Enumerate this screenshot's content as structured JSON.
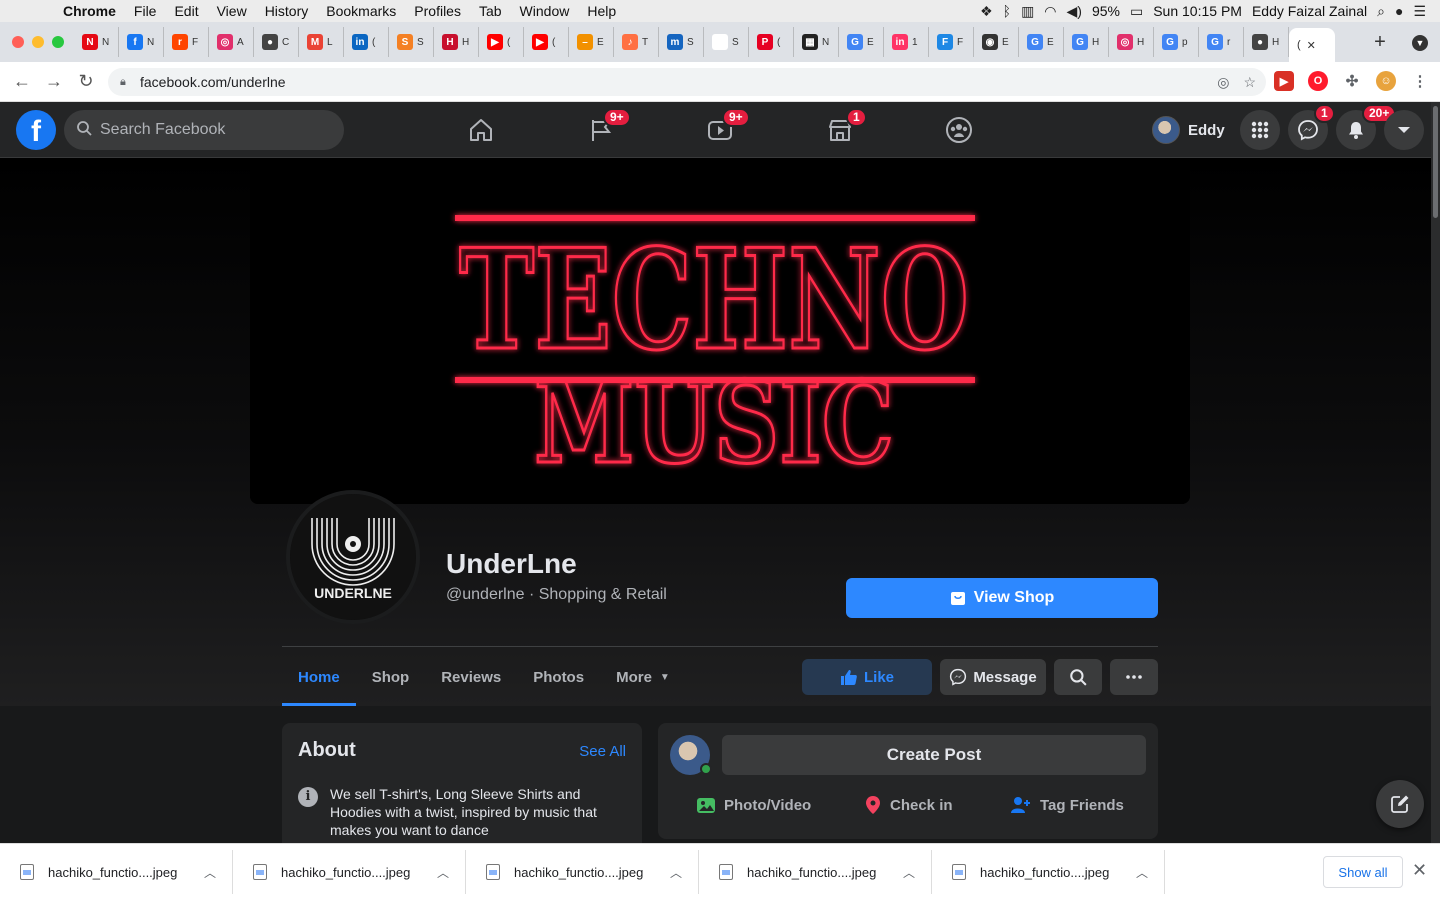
{
  "menubar": {
    "app_name": "Chrome",
    "items": [
      "File",
      "Edit",
      "View",
      "History",
      "Bookmarks",
      "Profiles",
      "Tab",
      "Window",
      "Help"
    ],
    "battery": "95%",
    "clock": "Sun 10:15 PM",
    "user": "Eddy Faizal Zainal"
  },
  "tabs": [
    {
      "fav": "N",
      "color": "#e50914",
      "label": "N"
    },
    {
      "fav": "f",
      "color": "#1877f2",
      "label": "N"
    },
    {
      "fav": "r",
      "color": "#ff4500",
      "label": "F"
    },
    {
      "fav": "◎",
      "color": "#e1306c",
      "label": "A"
    },
    {
      "fav": "●",
      "color": "#444444",
      "label": "C"
    },
    {
      "fav": "M",
      "color": "#ea4335",
      "label": "L"
    },
    {
      "fav": "in",
      "color": "#0a66c2",
      "label": "("
    },
    {
      "fav": "S",
      "color": "#f48024",
      "label": "S"
    },
    {
      "fav": "H",
      "color": "#c8102e",
      "label": "H"
    },
    {
      "fav": "▶",
      "color": "#ff0000",
      "label": "("
    },
    {
      "fav": "▶",
      "color": "#ff0000",
      "label": "("
    },
    {
      "fav": "–",
      "color": "#f29100",
      "label": "E"
    },
    {
      "fav": "♪",
      "color": "#ff7043",
      "label": "T"
    },
    {
      "fav": "m",
      "color": "#1565c0",
      "label": "S"
    },
    {
      "fav": " ",
      "color": "#ffffff",
      "label": "S"
    },
    {
      "fav": "P",
      "color": "#e60023",
      "label": "("
    },
    {
      "fav": "▦",
      "color": "#222222",
      "label": "N"
    },
    {
      "fav": "G",
      "color": "#4285f4",
      "label": "E"
    },
    {
      "fav": "in",
      "color": "#ff3366",
      "label": "1"
    },
    {
      "fav": "F",
      "color": "#1e88e5",
      "label": "F"
    },
    {
      "fav": "◉",
      "color": "#333333",
      "label": "E"
    },
    {
      "fav": "G",
      "color": "#4285f4",
      "label": "E"
    },
    {
      "fav": "G",
      "color": "#4285f4",
      "label": "H"
    },
    {
      "fav": "◎",
      "color": "#e1306c",
      "label": "H"
    },
    {
      "fav": "G",
      "color": "#4285f4",
      "label": "p"
    },
    {
      "fav": "G",
      "color": "#4285f4",
      "label": "r"
    },
    {
      "fav": "●",
      "color": "#444444",
      "label": "H"
    }
  ],
  "active_tab": {
    "label": "(",
    "close": "✕"
  },
  "toolbar": {
    "back": "←",
    "forward": "→",
    "reload": "↻",
    "url": "facebook.com/underlne"
  },
  "facebook": {
    "logo": "f",
    "search_placeholder": "Search Facebook",
    "nav_badges": {
      "pages": "9+",
      "watch": "9+",
      "marketplace": "1"
    },
    "profile_name": "Eddy",
    "messenger_badge": "1",
    "notifications_badge": "20+"
  },
  "page": {
    "cover_line1": "TECHNO",
    "cover_line2": "MUSIC",
    "logo_text": "UNDERLNE",
    "name": "UnderLne",
    "subtitle": "@underlne · Shopping & Retail",
    "view_shop": "View Shop",
    "tabs": [
      "Home",
      "Shop",
      "Reviews",
      "Photos",
      "More"
    ],
    "actions": {
      "like": "Like",
      "message": "Message"
    }
  },
  "about": {
    "title": "About",
    "see_all": "See All",
    "text": "We sell T-shirt's, Long Sleeve Shirts and Hoodies with a twist, inspired by music that makes you want to dance"
  },
  "post": {
    "create": "Create Post",
    "actions": [
      "Photo/Video",
      "Check in",
      "Tag Friends"
    ]
  },
  "downloads": {
    "items": [
      "hachiko_functio....jpeg",
      "hachiko_functio....jpeg",
      "hachiko_functio....jpeg",
      "hachiko_functio....jpeg",
      "hachiko_functio....jpeg"
    ],
    "show_all": "Show all"
  },
  "colors": {
    "fb_blue": "#2d88ff",
    "fb_bg": "#18191a",
    "fb_card": "#242526",
    "neon_red": "#ff2a4a",
    "badge_red": "#e41e3f"
  }
}
